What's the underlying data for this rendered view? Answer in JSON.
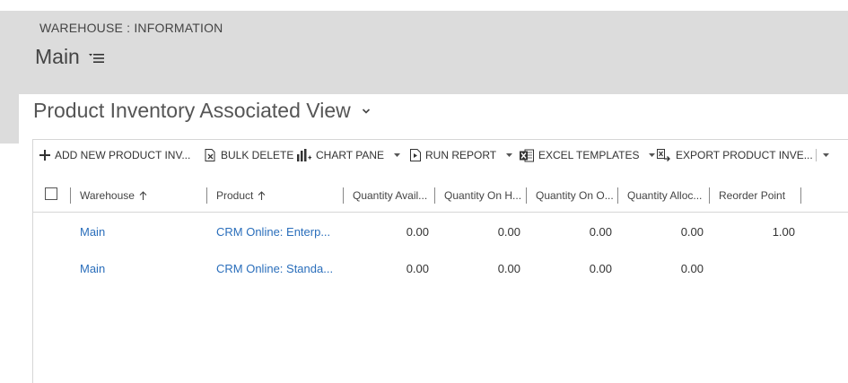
{
  "form": {
    "entity": "WAREHOUSE : INFORMATION",
    "title": "Main"
  },
  "view": {
    "title": "Product Inventory Associated View"
  },
  "commands": [
    {
      "label": "ADD NEW PRODUCT INV...",
      "icon": "plus-icon"
    },
    {
      "label": "BULK DELETE",
      "icon": "bulk-delete-icon"
    },
    {
      "label": "CHART PANE",
      "icon": "chart-icon",
      "dropdown": true
    },
    {
      "label": "RUN REPORT",
      "icon": "report-icon",
      "dropdown": true
    },
    {
      "label": "EXCEL TEMPLATES",
      "icon": "excel-icon",
      "dropdown": true
    },
    {
      "label": "EXPORT PRODUCT INVE...",
      "icon": "export-icon"
    }
  ],
  "columns": [
    {
      "label": "Warehouse",
      "sort": "ascending"
    },
    {
      "label": "Product",
      "sort": "ascending"
    },
    {
      "label": "Quantity Avail..."
    },
    {
      "label": "Quantity On H..."
    },
    {
      "label": "Quantity On O..."
    },
    {
      "label": "Quantity Alloc..."
    },
    {
      "label": "Reorder Point"
    }
  ],
  "rows": [
    {
      "warehouse": "Main",
      "product": "CRM Online: Enterp...",
      "available": "0.00",
      "on_hand": "0.00",
      "on_order": "0.00",
      "allocated": "0.00",
      "reorder": "1.00"
    },
    {
      "warehouse": "Main",
      "product": "CRM Online: Standa...",
      "available": "0.00",
      "on_hand": "0.00",
      "on_order": "0.00",
      "allocated": "0.00",
      "reorder": ""
    }
  ],
  "colors": {
    "header_bg": "#dcdcdc",
    "link": "#2a6ebb",
    "excel": "#217346"
  }
}
